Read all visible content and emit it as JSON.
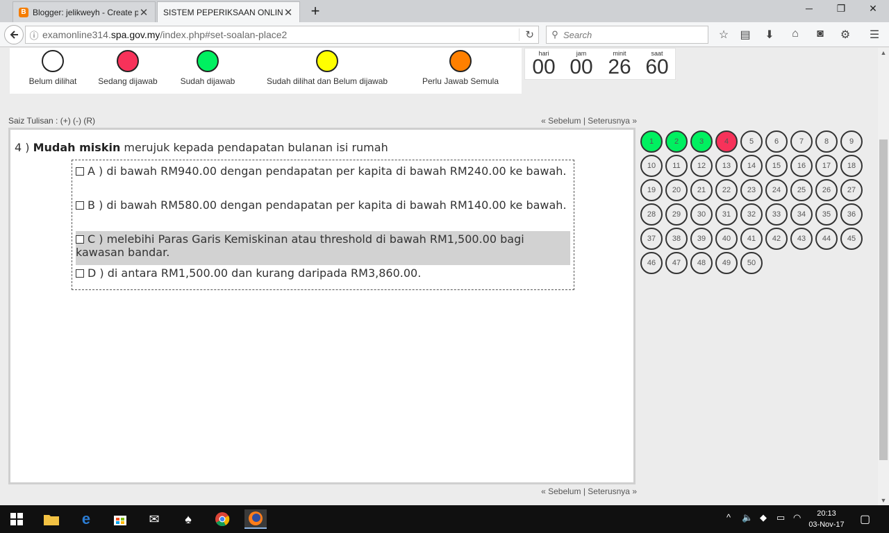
{
  "browser": {
    "tabs": [
      {
        "title": "Blogger: jelikweyh - Create p",
        "favicon": "B"
      },
      {
        "title": "SISTEM PEPERIKSAAN ONLINE (S"
      }
    ],
    "close_glyph": "✕",
    "newtab_glyph": "+",
    "window_controls": [
      "─",
      "❐",
      "✕"
    ],
    "url_prefix": "examonline314.",
    "url_host": "spa.gov.my",
    "url_path": "/index.php#set-soalan-place2",
    "search_placeholder": "Search",
    "toolbar_icons": [
      "star-icon",
      "reading-list-icon",
      "download-icon",
      "home-icon",
      "pocket-icon",
      "extension-icon",
      "menu-icon"
    ]
  },
  "legend": [
    {
      "label": "Belum dilihat",
      "color": "#ffffff"
    },
    {
      "label": "Sedang dijawab",
      "color": "#f7325a"
    },
    {
      "label": "Sudah dijawab",
      "color": "#00f060"
    },
    {
      "label": "Sudah dilihat dan Belum dijawab",
      "color": "#ffff00"
    },
    {
      "label": "Perlu Jawab Semula",
      "color": "#ff8000"
    }
  ],
  "timer": {
    "labels": {
      "hari": "hari",
      "jam": "jam",
      "minit": "minit",
      "saat": "saat"
    },
    "values": {
      "hari": "00",
      "jam": "00",
      "minit": "26",
      "saat": "60"
    }
  },
  "font_size_control": "Saiz Tulisan : (+) (-) (R)",
  "nav": {
    "prev": "« Sebelum",
    "sep": "|",
    "next": "Seterusnya »"
  },
  "question": {
    "number": "4 )",
    "term": "Mudah miskin",
    "text": "merujuk kepada pendapatan bulanan isi rumah",
    "options": [
      {
        "text": "A ) di bawah RM940.00 dengan pendapatan per kapita di bawah RM240.00 ke bawah.",
        "highlighted": false
      },
      {
        "text": "B ) di bawah RM580.00 dengan pendapatan per kapita di bawah RM140.00 ke bawah.",
        "highlighted": false
      },
      {
        "text": "C ) melebihi Paras Garis Kemiskinan atau threshold di bawah RM1,500.00 bagi kawasan bandar.",
        "highlighted": true
      },
      {
        "text": "D ) di antara RM1,500.00 dan kurang daripada RM3,860.00.",
        "highlighted": false
      }
    ]
  },
  "question_grid": {
    "answered": [
      "1",
      "2",
      "3"
    ],
    "current": "4",
    "numbers": [
      "1",
      "2",
      "3",
      "4",
      "5",
      "6",
      "7",
      "8",
      "9",
      "10",
      "11",
      "12",
      "13",
      "14",
      "15",
      "16",
      "17",
      "18",
      "19",
      "20",
      "21",
      "22",
      "23",
      "24",
      "25",
      "26",
      "27",
      "28",
      "29",
      "30",
      "31",
      "32",
      "33",
      "34",
      "35",
      "36",
      "37",
      "38",
      "39",
      "40",
      "41",
      "42",
      "43",
      "44",
      "45",
      "46",
      "47",
      "48",
      "49",
      "50"
    ],
    "colors": {
      "answered": "#00f060",
      "current": "#f7325a",
      "default": "#ececec"
    }
  },
  "taskbar": {
    "apps": [
      "windows-start-icon",
      "file-explorer-icon",
      "edge-icon",
      "store-icon",
      "mail-icon",
      "solitaire-icon",
      "chrome-icon",
      "firefox-icon"
    ],
    "time": "20:13",
    "date": "03-Nov-17"
  }
}
